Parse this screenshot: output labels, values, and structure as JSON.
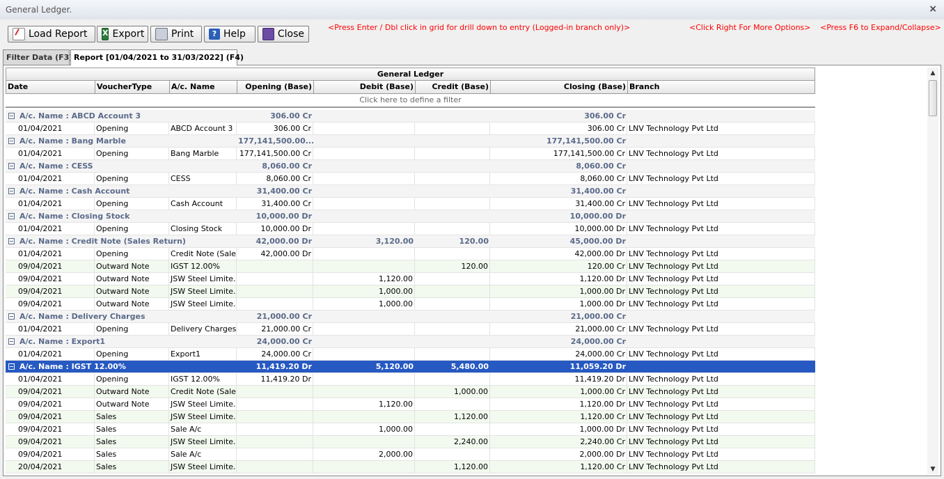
{
  "window": {
    "title": "General Ledger.",
    "close_glyph": "×"
  },
  "toolbar": {
    "buttons": [
      {
        "label": "Load Report",
        "icon": "load-report-icon"
      },
      {
        "label": "Export",
        "icon": "excel-icon"
      },
      {
        "label": "Print",
        "icon": "printer-icon"
      },
      {
        "label": "Help",
        "icon": "help-icon"
      },
      {
        "label": "Close",
        "icon": "door-icon"
      }
    ],
    "hints": [
      "<Press Enter / Dbl click in grid for drill down to entry (Logged-in branch only)>",
      "<Click Right For More Options>",
      "<Press F6 to Expand/Collapse>"
    ]
  },
  "tabs": [
    {
      "label": "Filter Data (F3)",
      "active": false
    },
    {
      "label": "Report [01/04/2021 to 31/03/2022] (F4)",
      "active": true
    }
  ],
  "grid": {
    "band_title": "General Ledger",
    "columns": [
      "Date",
      "VoucherType",
      "A/c. Name",
      "Opening (Base)",
      "Debit (Base)",
      "Credit (Base)",
      "Closing (Base)",
      "Branch"
    ],
    "filter_prompt": "Click here to define a filter",
    "rows": [
      {
        "kind": "group",
        "name": "A/c. Name : ABCD Account 3",
        "opening": "306.00 Cr",
        "debit": "",
        "credit": "",
        "closing": "306.00 Cr"
      },
      {
        "kind": "detail",
        "date": "01/04/2021",
        "vtype": "Opening",
        "acname": "ABCD Account 3",
        "opening": "306.00 Cr",
        "debit": "",
        "credit": "",
        "closing": "306.00 Cr",
        "branch": "LNV Technology Pvt Ltd"
      },
      {
        "kind": "group",
        "name": "A/c. Name : Bang Marble",
        "opening": "177,141,500.00...",
        "debit": "",
        "credit": "",
        "closing": "177,141,500.00 Cr"
      },
      {
        "kind": "detail",
        "date": "01/04/2021",
        "vtype": "Opening",
        "acname": "Bang Marble",
        "opening": "177,141,500.00 Cr",
        "debit": "",
        "credit": "",
        "closing": "177,141,500.00 Cr",
        "branch": "LNV Technology Pvt Ltd"
      },
      {
        "kind": "group",
        "name": "A/c. Name : CESS",
        "opening": "8,060.00 Cr",
        "debit": "",
        "credit": "",
        "closing": "8,060.00 Cr"
      },
      {
        "kind": "detail",
        "date": "01/04/2021",
        "vtype": "Opening",
        "acname": "CESS",
        "opening": "8,060.00 Cr",
        "debit": "",
        "credit": "",
        "closing": "8,060.00 Cr",
        "branch": "LNV Technology Pvt Ltd"
      },
      {
        "kind": "group",
        "name": "A/c. Name : Cash Account",
        "opening": "31,400.00 Cr",
        "debit": "",
        "credit": "",
        "closing": "31,400.00 Cr"
      },
      {
        "kind": "detail",
        "date": "01/04/2021",
        "vtype": "Opening",
        "acname": "Cash Account",
        "opening": "31,400.00 Cr",
        "debit": "",
        "credit": "",
        "closing": "31,400.00 Cr",
        "branch": "LNV Technology Pvt Ltd"
      },
      {
        "kind": "group",
        "name": "A/c. Name : Closing Stock",
        "opening": "10,000.00 Dr",
        "debit": "",
        "credit": "",
        "closing": "10,000.00 Dr"
      },
      {
        "kind": "detail",
        "date": "01/04/2021",
        "vtype": "Opening",
        "acname": "Closing Stock",
        "opening": "10,000.00 Dr",
        "debit": "",
        "credit": "",
        "closing": "10,000.00 Dr",
        "branch": "LNV Technology Pvt Ltd"
      },
      {
        "kind": "group",
        "name": "A/c. Name : Credit Note (Sales Return)",
        "opening": "42,000.00 Dr",
        "debit": "3,120.00",
        "credit": "120.00",
        "closing": "45,000.00 Dr"
      },
      {
        "kind": "detail",
        "date": "01/04/2021",
        "vtype": "Opening",
        "acname": "Credit Note (Sale...",
        "opening": "42,000.00 Dr",
        "debit": "",
        "credit": "",
        "closing": "42,000.00 Dr",
        "branch": "LNV Technology Pvt Ltd"
      },
      {
        "kind": "detail",
        "date": "09/04/2021",
        "vtype": "Outward Note",
        "acname": "IGST 12.00%",
        "opening": "",
        "debit": "",
        "credit": "120.00",
        "closing": "120.00 Cr",
        "branch": "LNV Technology Pvt Ltd"
      },
      {
        "kind": "detail",
        "date": "09/04/2021",
        "vtype": "Outward Note",
        "acname": "JSW Steel Limite...",
        "opening": "",
        "debit": "1,120.00",
        "credit": "",
        "closing": "1,120.00 Dr",
        "branch": "LNV Technology Pvt Ltd"
      },
      {
        "kind": "detail",
        "date": "09/04/2021",
        "vtype": "Outward Note",
        "acname": "JSW Steel Limite...",
        "opening": "",
        "debit": "1,000.00",
        "credit": "",
        "closing": "1,000.00 Dr",
        "branch": "LNV Technology Pvt Ltd"
      },
      {
        "kind": "detail",
        "date": "09/04/2021",
        "vtype": "Outward Note",
        "acname": "JSW Steel Limite...",
        "opening": "",
        "debit": "1,000.00",
        "credit": "",
        "closing": "1,000.00 Dr",
        "branch": "LNV Technology Pvt Ltd"
      },
      {
        "kind": "group",
        "name": "A/c. Name : Delivery Charges",
        "opening": "21,000.00 Cr",
        "debit": "",
        "credit": "",
        "closing": "21,000.00 Cr"
      },
      {
        "kind": "detail",
        "date": "01/04/2021",
        "vtype": "Opening",
        "acname": "Delivery Charges",
        "opening": "21,000.00 Cr",
        "debit": "",
        "credit": "",
        "closing": "21,000.00 Cr",
        "branch": "LNV Technology Pvt Ltd"
      },
      {
        "kind": "group",
        "name": "A/c. Name : Export1",
        "opening": "24,000.00 Cr",
        "debit": "",
        "credit": "",
        "closing": "24,000.00 Cr"
      },
      {
        "kind": "detail",
        "date": "01/04/2021",
        "vtype": "Opening",
        "acname": "Export1",
        "opening": "24,000.00 Cr",
        "debit": "",
        "credit": "",
        "closing": "24,000.00 Cr",
        "branch": "LNV Technology Pvt Ltd"
      },
      {
        "kind": "group",
        "selected": true,
        "name": "A/c. Name : IGST 12.00%",
        "opening": "11,419.20 Dr",
        "debit": "5,120.00",
        "credit": "5,480.00",
        "closing": "11,059.20 Dr"
      },
      {
        "kind": "detail",
        "date": "01/04/2021",
        "vtype": "Opening",
        "acname": "IGST 12.00%",
        "opening": "11,419.20 Dr",
        "debit": "",
        "credit": "",
        "closing": "11,419.20 Dr",
        "branch": "LNV Technology Pvt Ltd"
      },
      {
        "kind": "detail",
        "date": "09/04/2021",
        "vtype": "Outward Note",
        "acname": "Credit Note (Sale...",
        "opening": "",
        "debit": "",
        "credit": "1,000.00",
        "closing": "1,000.00 Cr",
        "branch": "LNV Technology Pvt Ltd"
      },
      {
        "kind": "detail",
        "date": "09/04/2021",
        "vtype": "Outward Note",
        "acname": "JSW Steel Limite...",
        "opening": "",
        "debit": "1,120.00",
        "credit": "",
        "closing": "1,120.00 Dr",
        "branch": "LNV Technology Pvt Ltd"
      },
      {
        "kind": "detail",
        "date": "09/04/2021",
        "vtype": "Sales",
        "acname": "JSW Steel Limite...",
        "opening": "",
        "debit": "",
        "credit": "1,120.00",
        "closing": "1,120.00 Cr",
        "branch": "LNV Technology Pvt Ltd"
      },
      {
        "kind": "detail",
        "date": "09/04/2021",
        "vtype": "Sales",
        "acname": "Sale A/c",
        "opening": "",
        "debit": "1,000.00",
        "credit": "",
        "closing": "1,000.00 Dr",
        "branch": "LNV Technology Pvt Ltd"
      },
      {
        "kind": "detail",
        "date": "09/04/2021",
        "vtype": "Sales",
        "acname": "JSW Steel Limite...",
        "opening": "",
        "debit": "",
        "credit": "2,240.00",
        "closing": "2,240.00 Cr",
        "branch": "LNV Technology Pvt Ltd"
      },
      {
        "kind": "detail",
        "date": "09/04/2021",
        "vtype": "Sales",
        "acname": "Sale A/c",
        "opening": "",
        "debit": "2,000.00",
        "credit": "",
        "closing": "2,000.00 Dr",
        "branch": "LNV Technology Pvt Ltd"
      },
      {
        "kind": "detail",
        "date": "20/04/2021",
        "vtype": "Sales",
        "acname": "JSW Steel Limite...",
        "opening": "",
        "debit": "",
        "credit": "1,120.00",
        "closing": "1,120.00 Cr",
        "branch": "LNV Technology Pvt Ltd"
      }
    ]
  },
  "scrollbar": {
    "up_glyph": "▲",
    "down_glyph": "▼"
  },
  "colors": {
    "selected_row": "#2659c2",
    "group_text": "#5a6a8a",
    "hint_text": "#ff0000",
    "alt_row": "#f2f9ee"
  }
}
